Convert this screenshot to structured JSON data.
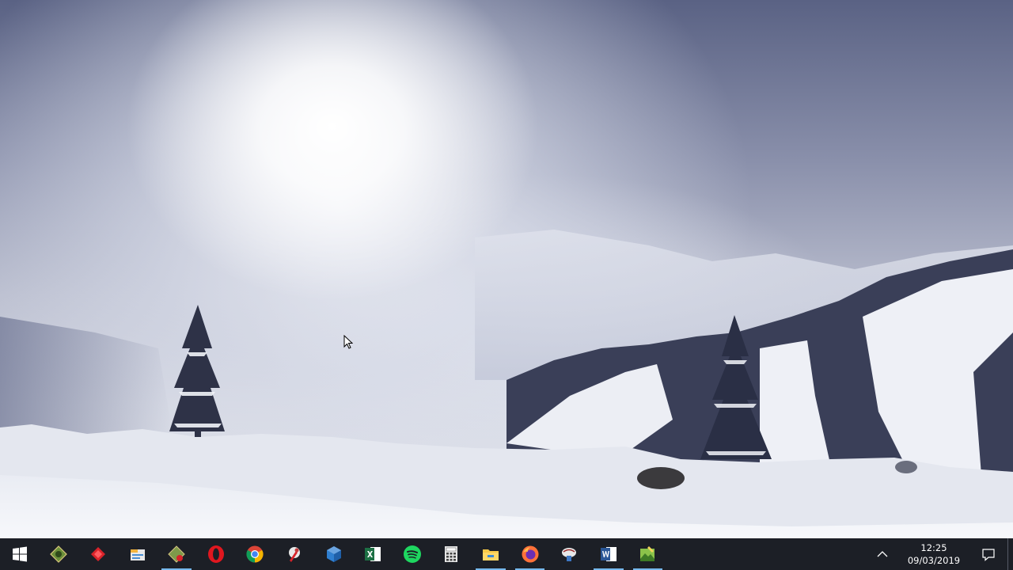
{
  "desktop": {
    "wallpaper": "snowy-mountain-landscape",
    "colors": {
      "sky_dark": "#5a6284",
      "snow": "#f2f4f8",
      "trees": "#2a2f45"
    }
  },
  "taskbar": {
    "background": "#1c1f26",
    "start_icon": "windows-logo-icon",
    "apps": [
      {
        "name": "green-photo-app-icon",
        "active": false
      },
      {
        "name": "red-diamond-app-icon",
        "active": false
      },
      {
        "name": "file-manager-app-icon",
        "active": false
      },
      {
        "name": "image-editor-app-icon",
        "active": true
      },
      {
        "name": "opera-browser-icon",
        "active": false
      },
      {
        "name": "chrome-browser-icon",
        "active": false
      },
      {
        "name": "paint-tool-app-icon",
        "active": false
      },
      {
        "name": "virtualbox-icon",
        "active": false
      },
      {
        "name": "excel-icon",
        "active": false
      },
      {
        "name": "spotify-icon",
        "active": false
      },
      {
        "name": "calculator-icon",
        "active": false
      },
      {
        "name": "file-explorer-icon",
        "active": true
      },
      {
        "name": "firefox-browser-icon",
        "active": true
      },
      {
        "name": "network-app-icon",
        "active": false
      },
      {
        "name": "word-icon",
        "active": true
      },
      {
        "name": "image-viewer-app-icon",
        "active": true
      }
    ],
    "tray": {
      "time": "12:25",
      "date": "09/03/2019",
      "chevron_icon": "chevron-up-icon",
      "notification_icon": "action-center-icon"
    }
  }
}
